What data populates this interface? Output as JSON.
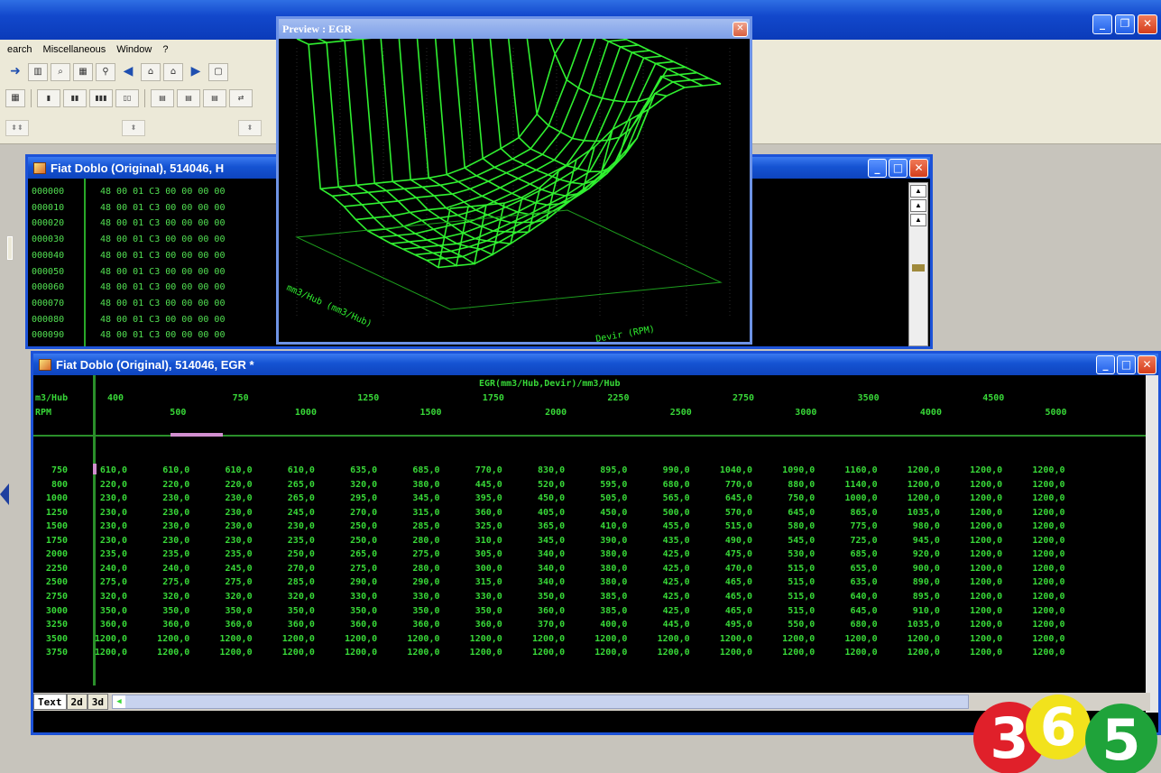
{
  "menu": [
    "earch",
    "Miscellaneous",
    "Window",
    "?"
  ],
  "hex_window": {
    "title": "Fiat Doblo (Original), 514046, H",
    "rows": [
      {
        "addr": "000000",
        "bytes": "48 00 01 C3 00 00 00 00"
      },
      {
        "addr": "000010",
        "bytes": "48 00 01 C3 00 00 00 00"
      },
      {
        "addr": "000020",
        "bytes": "48 00 01 C3 00 00 00 00"
      },
      {
        "addr": "000030",
        "bytes": "48 00 01 C3 00 00 00 00"
      },
      {
        "addr": "000040",
        "bytes": "48 00 01 C3 00 00 00 00"
      },
      {
        "addr": "000050",
        "bytes": "48 00 01 C3 00 00 00 00"
      },
      {
        "addr": "000060",
        "bytes": "48 00 01 C3 00 00 00 00"
      },
      {
        "addr": "000070",
        "bytes": "48 00 01 C3 00 00 00 00"
      },
      {
        "addr": "000080",
        "bytes": "48 00 01 C3 00 00 00 00"
      },
      {
        "addr": "000090",
        "bytes": "48 00 01 C3 00 00 00 00"
      }
    ]
  },
  "preview": {
    "title": "Preview : EGR",
    "axis_left": "mm3/Hub (mm3/Hub)",
    "axis_right": "Devir (RPM)"
  },
  "table_window": {
    "title": "Fiat Doblo (Original), 514046, EGR *",
    "map_name": "EGR(mm3/Hub,Devir)/mm3/Hub",
    "corner_top": "m3/Hub",
    "corner_bottom": "RPM",
    "header_top": [
      "400",
      "750",
      "1250",
      "1750",
      "2250",
      "2750",
      "3500",
      "4500"
    ],
    "header_bottom": [
      "500",
      "1000",
      "1500",
      "2000",
      "2500",
      "3000",
      "4000",
      "5000"
    ],
    "row_labels": [
      "750",
      "800",
      "1000",
      "1250",
      "1500",
      "1750",
      "2000",
      "2250",
      "2500",
      "2750",
      "3000",
      "3250",
      "3500",
      "3750"
    ],
    "rows": [
      [
        "610,0",
        "610,0",
        "610,0",
        "610,0",
        "635,0",
        "685,0",
        "770,0",
        "830,0",
        "895,0",
        "990,0",
        "1040,0",
        "1090,0",
        "1160,0",
        "1200,0",
        "1200,0",
        "1200,0"
      ],
      [
        "220,0",
        "220,0",
        "220,0",
        "265,0",
        "320,0",
        "380,0",
        "445,0",
        "520,0",
        "595,0",
        "680,0",
        "770,0",
        "880,0",
        "1140,0",
        "1200,0",
        "1200,0",
        "1200,0"
      ],
      [
        "230,0",
        "230,0",
        "230,0",
        "265,0",
        "295,0",
        "345,0",
        "395,0",
        "450,0",
        "505,0",
        "565,0",
        "645,0",
        "750,0",
        "1000,0",
        "1200,0",
        "1200,0",
        "1200,0"
      ],
      [
        "230,0",
        "230,0",
        "230,0",
        "245,0",
        "270,0",
        "315,0",
        "360,0",
        "405,0",
        "450,0",
        "500,0",
        "570,0",
        "645,0",
        "865,0",
        "1035,0",
        "1200,0",
        "1200,0"
      ],
      [
        "230,0",
        "230,0",
        "230,0",
        "230,0",
        "250,0",
        "285,0",
        "325,0",
        "365,0",
        "410,0",
        "455,0",
        "515,0",
        "580,0",
        "775,0",
        "980,0",
        "1200,0",
        "1200,0"
      ],
      [
        "230,0",
        "230,0",
        "230,0",
        "235,0",
        "250,0",
        "280,0",
        "310,0",
        "345,0",
        "390,0",
        "435,0",
        "490,0",
        "545,0",
        "725,0",
        "945,0",
        "1200,0",
        "1200,0"
      ],
      [
        "235,0",
        "235,0",
        "235,0",
        "250,0",
        "265,0",
        "275,0",
        "305,0",
        "340,0",
        "380,0",
        "425,0",
        "475,0",
        "530,0",
        "685,0",
        "920,0",
        "1200,0",
        "1200,0"
      ],
      [
        "240,0",
        "240,0",
        "245,0",
        "270,0",
        "275,0",
        "280,0",
        "300,0",
        "340,0",
        "380,0",
        "425,0",
        "470,0",
        "515,0",
        "655,0",
        "900,0",
        "1200,0",
        "1200,0"
      ],
      [
        "275,0",
        "275,0",
        "275,0",
        "285,0",
        "290,0",
        "290,0",
        "315,0",
        "340,0",
        "380,0",
        "425,0",
        "465,0",
        "515,0",
        "635,0",
        "890,0",
        "1200,0",
        "1200,0"
      ],
      [
        "320,0",
        "320,0",
        "320,0",
        "320,0",
        "330,0",
        "330,0",
        "330,0",
        "350,0",
        "385,0",
        "425,0",
        "465,0",
        "515,0",
        "640,0",
        "895,0",
        "1200,0",
        "1200,0"
      ],
      [
        "350,0",
        "350,0",
        "350,0",
        "350,0",
        "350,0",
        "350,0",
        "350,0",
        "360,0",
        "385,0",
        "425,0",
        "465,0",
        "515,0",
        "645,0",
        "910,0",
        "1200,0",
        "1200,0"
      ],
      [
        "360,0",
        "360,0",
        "360,0",
        "360,0",
        "360,0",
        "360,0",
        "360,0",
        "370,0",
        "400,0",
        "445,0",
        "495,0",
        "550,0",
        "680,0",
        "1035,0",
        "1200,0",
        "1200,0"
      ],
      [
        "1200,0",
        "1200,0",
        "1200,0",
        "1200,0",
        "1200,0",
        "1200,0",
        "1200,0",
        "1200,0",
        "1200,0",
        "1200,0",
        "1200,0",
        "1200,0",
        "1200,0",
        "1200,0",
        "1200,0",
        "1200,0"
      ],
      [
        "1200,0",
        "1200,0",
        "1200,0",
        "1200,0",
        "1200,0",
        "1200,0",
        "1200,0",
        "1200,0",
        "1200,0",
        "1200,0",
        "1200,0",
        "1200,0",
        "1200,0",
        "1200,0",
        "1200,0",
        "1200,0"
      ]
    ],
    "tabs": [
      "Text",
      "2d",
      "3d"
    ],
    "active_tab": "Text"
  },
  "logo_digits": [
    "3",
    "6",
    "5"
  ],
  "colors": {
    "map_green": "#38d838",
    "window_blue": "#1c52d8",
    "logo_red": "#e0202a",
    "logo_yellow": "#f2e21c",
    "logo_green": "#1fa33a"
  }
}
